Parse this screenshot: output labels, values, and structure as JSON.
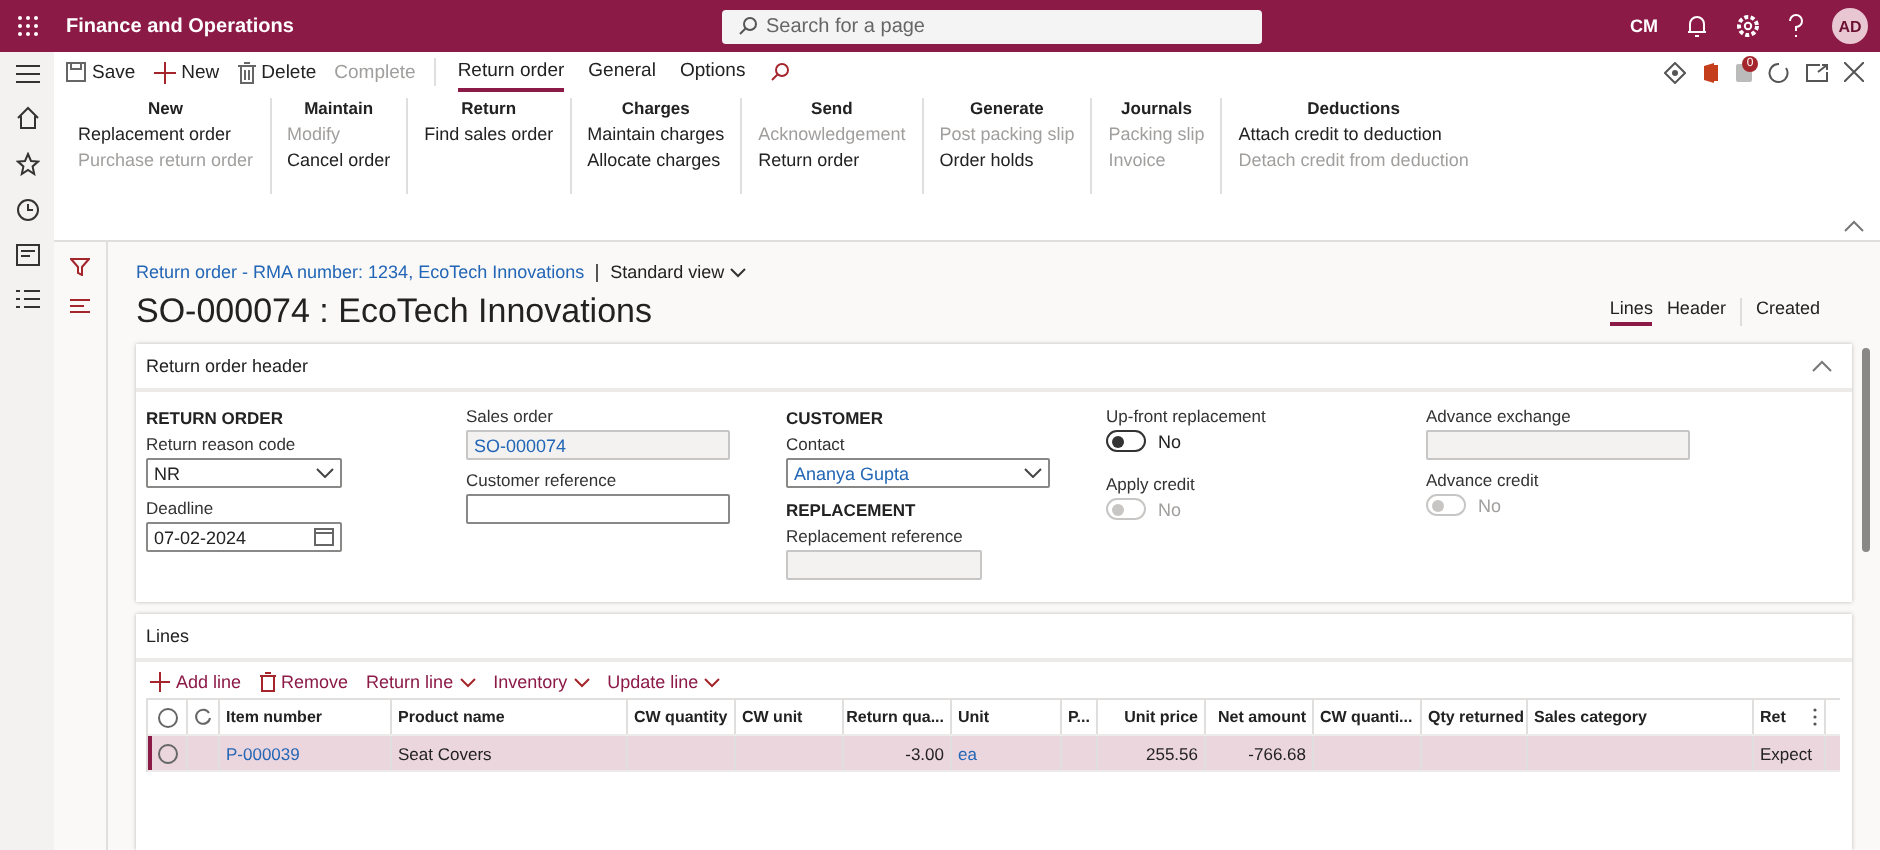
{
  "app": {
    "title": "Finance and Operations",
    "search_placeholder": "Search for a page",
    "company": "CM",
    "avatar": "AD",
    "badge_count": "0"
  },
  "toolbar": {
    "buttons": [
      {
        "label": "Save",
        "kind": "save",
        "disabled": false
      },
      {
        "label": "New",
        "kind": "new",
        "disabled": false
      },
      {
        "label": "Delete",
        "kind": "delete",
        "disabled": false
      },
      {
        "label": "Complete",
        "kind": "plain",
        "disabled": true
      }
    ],
    "tabs": [
      {
        "label": "Return order",
        "selected": true
      },
      {
        "label": "General",
        "selected": false
      },
      {
        "label": "Options",
        "selected": false
      }
    ]
  },
  "ribbon": [
    {
      "title": "New",
      "items": [
        {
          "label": "Replacement order",
          "disabled": false
        },
        {
          "label": "Purchase return order",
          "disabled": true
        }
      ]
    },
    {
      "title": "Maintain",
      "items": [
        {
          "label": "Modify",
          "disabled": true
        },
        {
          "label": "Cancel order",
          "disabled": false
        }
      ]
    },
    {
      "title": "Return",
      "items": [
        {
          "label": "Find sales order",
          "disabled": false
        }
      ]
    },
    {
      "title": "Charges",
      "items": [
        {
          "label": "Maintain charges",
          "disabled": false
        },
        {
          "label": "Allocate charges",
          "disabled": false
        }
      ]
    },
    {
      "title": "Send",
      "items": [
        {
          "label": "Acknowledgement",
          "disabled": true
        },
        {
          "label": "Return order",
          "disabled": false
        }
      ]
    },
    {
      "title": "Generate",
      "items": [
        {
          "label": "Post packing slip",
          "disabled": true
        },
        {
          "label": "Order holds",
          "disabled": false
        }
      ]
    },
    {
      "title": "Journals",
      "items": [
        {
          "label": "Packing slip",
          "disabled": true
        },
        {
          "label": "Invoice",
          "disabled": true
        }
      ]
    },
    {
      "title": "Deductions",
      "items": [
        {
          "label": "Attach credit to deduction",
          "disabled": false
        },
        {
          "label": "Detach credit from deduction",
          "disabled": true
        }
      ]
    }
  ],
  "page": {
    "breadcrumb": "Return order - RMA number: 1234, EcoTech Innovations",
    "view": "Standard view",
    "title": "SO-000074 : EcoTech Innovations",
    "tabs": [
      {
        "label": "Lines",
        "selected": true
      },
      {
        "label": "Header",
        "selected": false
      },
      {
        "label": "Created",
        "selected": false
      }
    ]
  },
  "header": {
    "title": "Return order header",
    "columns": [
      [
        {
          "kind": "heading",
          "label": "RETURN ORDER"
        },
        {
          "kind": "select",
          "label": "Return reason code",
          "value": "NR",
          "link": false,
          "disabled": false
        },
        {
          "kind": "date",
          "label": "Deadline",
          "value": "07-02-2024",
          "link": false,
          "disabled": false
        }
      ],
      [
        {
          "kind": "text",
          "label": "Sales order",
          "value": "SO-000074",
          "link": true,
          "disabled": true
        },
        {
          "kind": "text",
          "label": "Customer reference",
          "disabled": false
        }
      ],
      [
        {
          "kind": "heading",
          "label": "CUSTOMER"
        },
        {
          "kind": "select",
          "label": "Contact",
          "value": "Ananya Gupta",
          "link": true,
          "disabled": false
        },
        {
          "kind": "heading",
          "label": "REPLACEMENT"
        },
        {
          "kind": "text",
          "label": "Replacement reference",
          "disabled": true
        }
      ],
      [
        {
          "kind": "toggle",
          "label": "Up-front replacement",
          "value": "No",
          "on": false,
          "disabled": false
        },
        {
          "kind": "toggle",
          "label": "Apply credit",
          "value": "No",
          "on": false,
          "disabled": true
        }
      ],
      [
        {
          "kind": "text",
          "label": "Advance exchange",
          "disabled": true
        },
        {
          "kind": "toggle",
          "label": "Advance credit",
          "value": "No",
          "on": false,
          "disabled": true
        }
      ]
    ]
  },
  "lines": {
    "title": "Lines",
    "actions": [
      {
        "label": "Add line",
        "kind": "add"
      },
      {
        "label": "Remove",
        "kind": "remove"
      },
      {
        "label": "Return line",
        "kind": "menu"
      },
      {
        "label": "Inventory",
        "kind": "menu"
      },
      {
        "label": "Update line",
        "kind": "menu"
      }
    ],
    "all_checked": false,
    "columns": [
      {
        "label": "Item number",
        "kind": "link"
      },
      {
        "label": "Product name",
        "kind": "text"
      },
      {
        "label": "CW quantity",
        "kind": "text"
      },
      {
        "label": "CW unit",
        "kind": "text"
      },
      {
        "label": "Return qua...",
        "kind": "number"
      },
      {
        "label": "Unit",
        "kind": "link"
      },
      {
        "label": "P...",
        "kind": "text"
      },
      {
        "label": "Unit price",
        "kind": "number"
      },
      {
        "label": "Net amount",
        "kind": "number"
      },
      {
        "label": "CW quanti...",
        "kind": "text"
      },
      {
        "label": "Qty returned",
        "kind": "text"
      },
      {
        "label": "Sales category",
        "kind": "text"
      },
      {
        "label": "Ret",
        "kind": "text"
      }
    ],
    "rows": [
      {
        "selected": true,
        "checked": false,
        "cells": [
          "P-000039",
          "Seat Covers",
          null,
          null,
          "-3.00",
          "ea",
          null,
          "255.56",
          "-766.68",
          null,
          null,
          null,
          "Expect"
        ]
      }
    ]
  }
}
